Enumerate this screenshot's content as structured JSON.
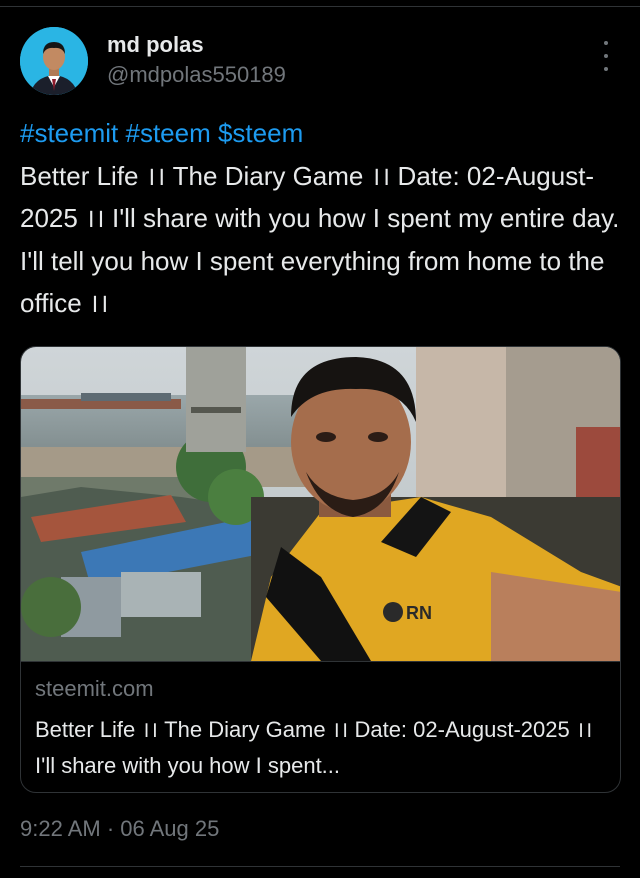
{
  "author": {
    "display_name": "md polas",
    "handle": "@mdpolas550189",
    "avatar_icon": "profile-photo"
  },
  "tweet": {
    "hashtags": "#steemit #steem $steem",
    "text": "Better Life ।। The Diary Game ।। Date: 02-August-2025 ।। I'll share with you how I spent my entire day. I'll tell you how I spent everything from home to the office ।।"
  },
  "link_card": {
    "domain": "steemit.com",
    "title": "Better Life ।। The Diary Game ।। Date: 02-August-2025 ।। I'll share with you how I spent..."
  },
  "timestamp": "9:22 AM · 06 Aug 25",
  "colors": {
    "background": "#000000",
    "link": "#1d9bf0",
    "text": "#e7e9ea",
    "muted": "#71767b",
    "border": "#2f3336"
  }
}
